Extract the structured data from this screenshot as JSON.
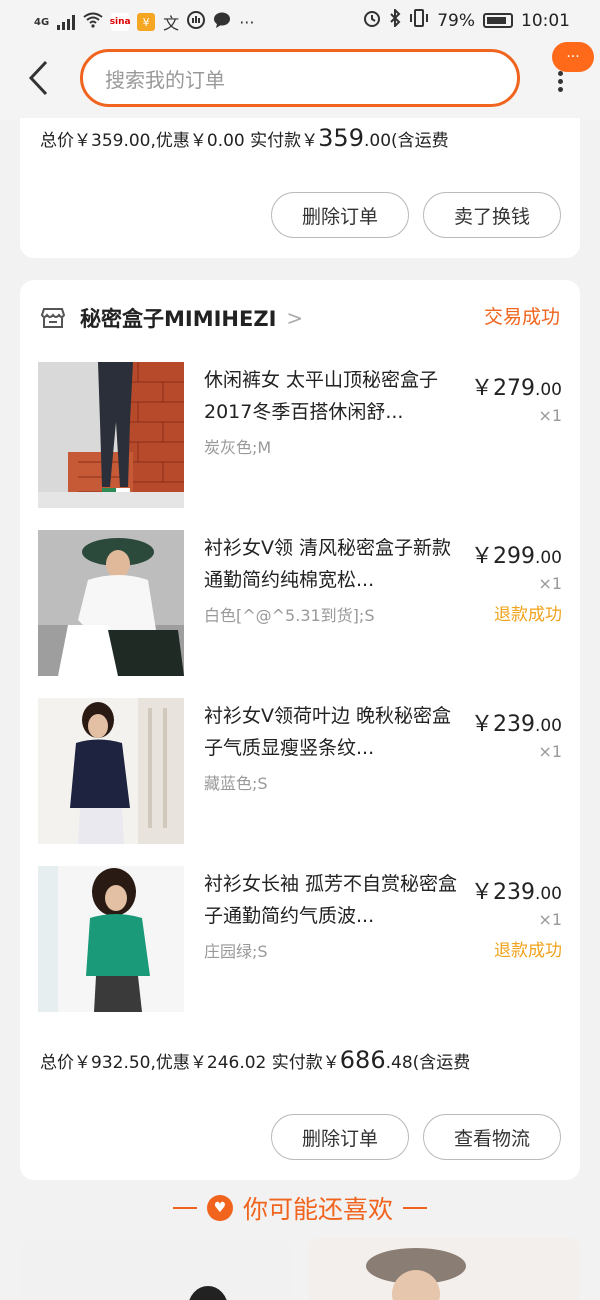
{
  "status_bar": {
    "network": "4G",
    "battery": "79%",
    "time": "10:01",
    "icons": [
      "signal-icon",
      "wifi-icon",
      "sina-icon",
      "yellow-app-icon",
      "translate-icon",
      "hand-icon",
      "chat-icon",
      "more-dots-icon",
      "alarm-icon",
      "bluetooth-icon",
      "vibrate-icon",
      "battery-icon"
    ]
  },
  "header": {
    "search_placeholder": "搜索我的订单",
    "more_badge": "···"
  },
  "order1": {
    "total_prefix": "总价￥359.00,优惠￥0.00  实付款￥",
    "paid_int": "359",
    "paid_dec": ".00",
    "shipping": "(含运费",
    "buttons": [
      "删除订单",
      "卖了换钱"
    ]
  },
  "order2": {
    "shop_name": "秘密盒子MIMIHEZI",
    "status": "交易成功",
    "items": [
      {
        "name": "休闲裤女 太平山顶秘密盒子2017冬季百搭休闲舒...",
        "spec": "炭灰色;M",
        "price_int": "￥279",
        "price_dec": ".00",
        "qty": "×1",
        "refund": ""
      },
      {
        "name": "衬衫女V领 清风秘密盒子新款通勤简约纯棉宽松...",
        "spec": "白色[^@^5.31到货];S",
        "price_int": "￥299",
        "price_dec": ".00",
        "qty": "×1",
        "refund": "退款成功"
      },
      {
        "name": "衬衫女V领荷叶边 晚秋秘密盒子气质显瘦竖条纹...",
        "spec": "藏蓝色;S",
        "price_int": "￥239",
        "price_dec": ".00",
        "qty": "×1",
        "refund": ""
      },
      {
        "name": "衬衫女长袖 孤芳不自赏秘密盒子通勤简约气质波...",
        "spec": "庄园绿;S",
        "price_int": "￥239",
        "price_dec": ".00",
        "qty": "×1",
        "refund": "退款成功"
      }
    ],
    "total_prefix": "总价￥932.50,优惠￥246.02  实付款￥",
    "paid_int": "686",
    "paid_dec": ".48",
    "shipping": "(含运费",
    "buttons": [
      "删除订单",
      "查看物流"
    ]
  },
  "recommend": {
    "title": "你可能还喜欢"
  },
  "colors": {
    "accent": "#f0641e",
    "refund": "#f0a31e"
  }
}
